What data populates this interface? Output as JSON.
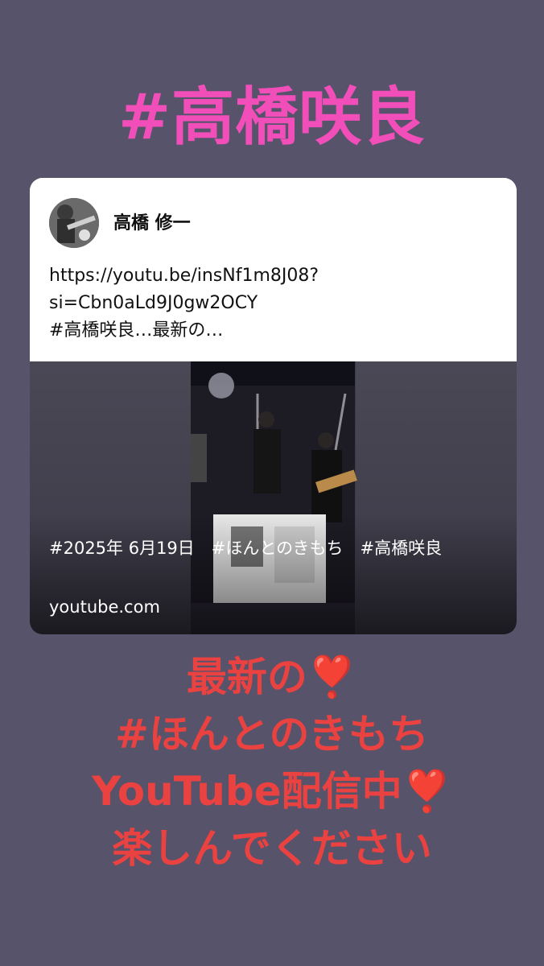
{
  "story": {
    "title": "#高橋咲良",
    "card": {
      "author": "高橋 修一",
      "text_lines": [
        "https://youtu.be/insNf1m8J08?",
        "si=Cbn0aLd9J0gw2OCY",
        "#高橋咲良…最新の…"
      ],
      "media_caption": "#2025年 6月19日　#ほんとのきもち　#高橋咲良",
      "media_domain": "youtube.com"
    },
    "message_lines": [
      "最新の",
      "#ほんとのきもち",
      "YouTube配信中",
      "楽しんでください"
    ],
    "heart_glyph": "❣️"
  },
  "colors": {
    "background": "#57536a",
    "title_pink": "#f24eb9",
    "message_red": "#ea4141"
  }
}
